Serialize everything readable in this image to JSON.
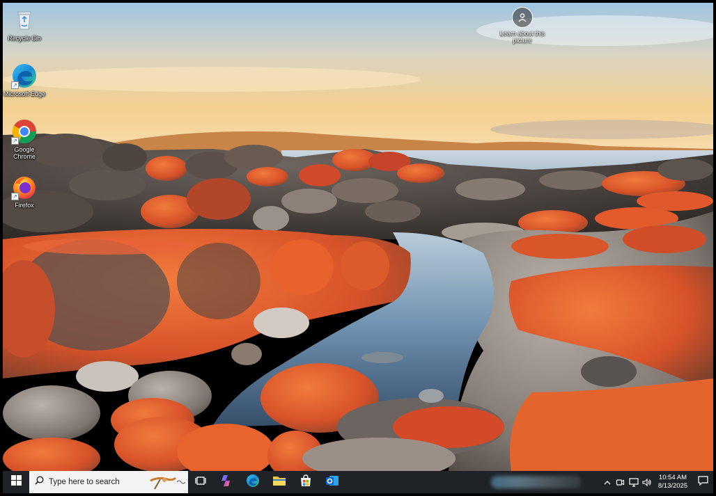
{
  "desktop": {
    "icons": [
      {
        "label": "Recycle Bin",
        "icon": "recycle-bin-icon"
      },
      {
        "label": "Microsoft Edge",
        "icon": "edge-icon"
      },
      {
        "label": "Google Chrome",
        "icon": "chrome-icon"
      },
      {
        "label": "Firefox",
        "icon": "firefox-icon"
      }
    ],
    "learn_about": {
      "label": "Learn about this picture",
      "icon": "camera-info-icon"
    }
  },
  "taskbar": {
    "start_icon": "windows-logo-icon",
    "search_placeholder": "Type here to search",
    "pinned": [
      {
        "name": "task-view",
        "icon": "task-view-icon"
      },
      {
        "name": "copilot",
        "icon": "copilot-icon"
      },
      {
        "name": "edge",
        "icon": "edge-icon"
      },
      {
        "name": "file-explorer",
        "icon": "folder-icon"
      },
      {
        "name": "microsoft-store",
        "icon": "store-icon"
      },
      {
        "name": "outlook",
        "icon": "outlook-icon"
      }
    ],
    "tray": {
      "icons": [
        "chevron-up-icon",
        "meet-now-icon",
        "network-icon",
        "volume-icon"
      ],
      "time": "10:54 AM",
      "date": "8/13/2025",
      "notification_icon": "notification-icon"
    }
  },
  "colors": {
    "taskbar": "#1f2226",
    "search_bg": "#f3f3f3",
    "lichen_orange": "#e8582a"
  }
}
